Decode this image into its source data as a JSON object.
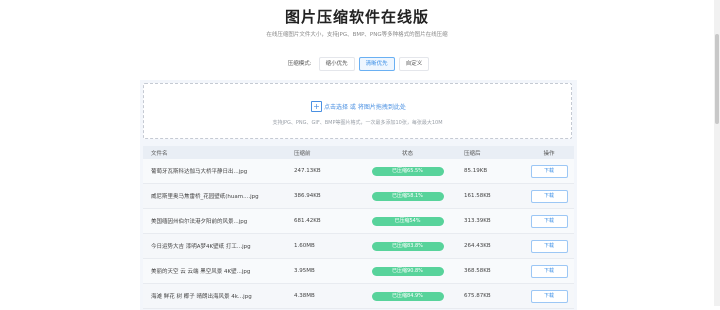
{
  "page": {
    "title": "图片压缩软件在线版",
    "subtitle": "在线压缩图片文件大小，支持JPG、BMP、PNG等多种格式的图片在线压缩"
  },
  "modes": {
    "label": "压缩模式:",
    "options": [
      {
        "label": "缩小优先",
        "active": false
      },
      {
        "label": "清晰优先",
        "active": true
      },
      {
        "label": "自定义",
        "active": false
      }
    ]
  },
  "upload": {
    "icon": "plus-icon",
    "text": "点击选择 或 将图片拖拽到此处",
    "hint": "支持JPG、PNG、GIF、BMP等图片格式，一次最多添加10张，每张最大10M"
  },
  "table": {
    "headers": {
      "name": "文件名",
      "before": "压缩前",
      "status": "状态",
      "after": "压缩后",
      "op": "操作"
    },
    "rows": [
      {
        "name": "葡萄牙瓦斯科达伽马大桥平静日出...jpg",
        "before": "247.13KB",
        "status": "已压缩65.5%",
        "after": "85.19KB",
        "action": "下载"
      },
      {
        "name": "威尼斯里奥马焦雷桥_花园壁纸(huam....jpg",
        "before": "386.94KB",
        "status": "已压缩58.1%",
        "after": "161.58KB",
        "action": "下载"
      },
      {
        "name": "美国缅因州伯尔法港夕阳前的风景...jpg",
        "before": "681.42KB",
        "status": "已压缩54%",
        "after": "313.39KB",
        "action": "下载"
      },
      {
        "name": "今日运势大吉 漆明A梦4K壁纸 打工...jpg",
        "before": "1.60MB",
        "status": "已压缩83.8%",
        "after": "264.43KB",
        "action": "下载"
      },
      {
        "name": "美丽的天空 云 云端 黑空风景 4K壁...jpg",
        "before": "3.95MB",
        "status": "已压缩90.8%",
        "after": "368.58KB",
        "action": "下载"
      },
      {
        "name": "海滩 鲜花 树 椰子 晴朗出海风景 4k...jpg",
        "before": "4.38MB",
        "status": "已压缩84.9%",
        "after": "675.87KB",
        "action": "下载"
      }
    ]
  },
  "colors": {
    "accent": "#4a90e2",
    "status": "#58d39b"
  }
}
